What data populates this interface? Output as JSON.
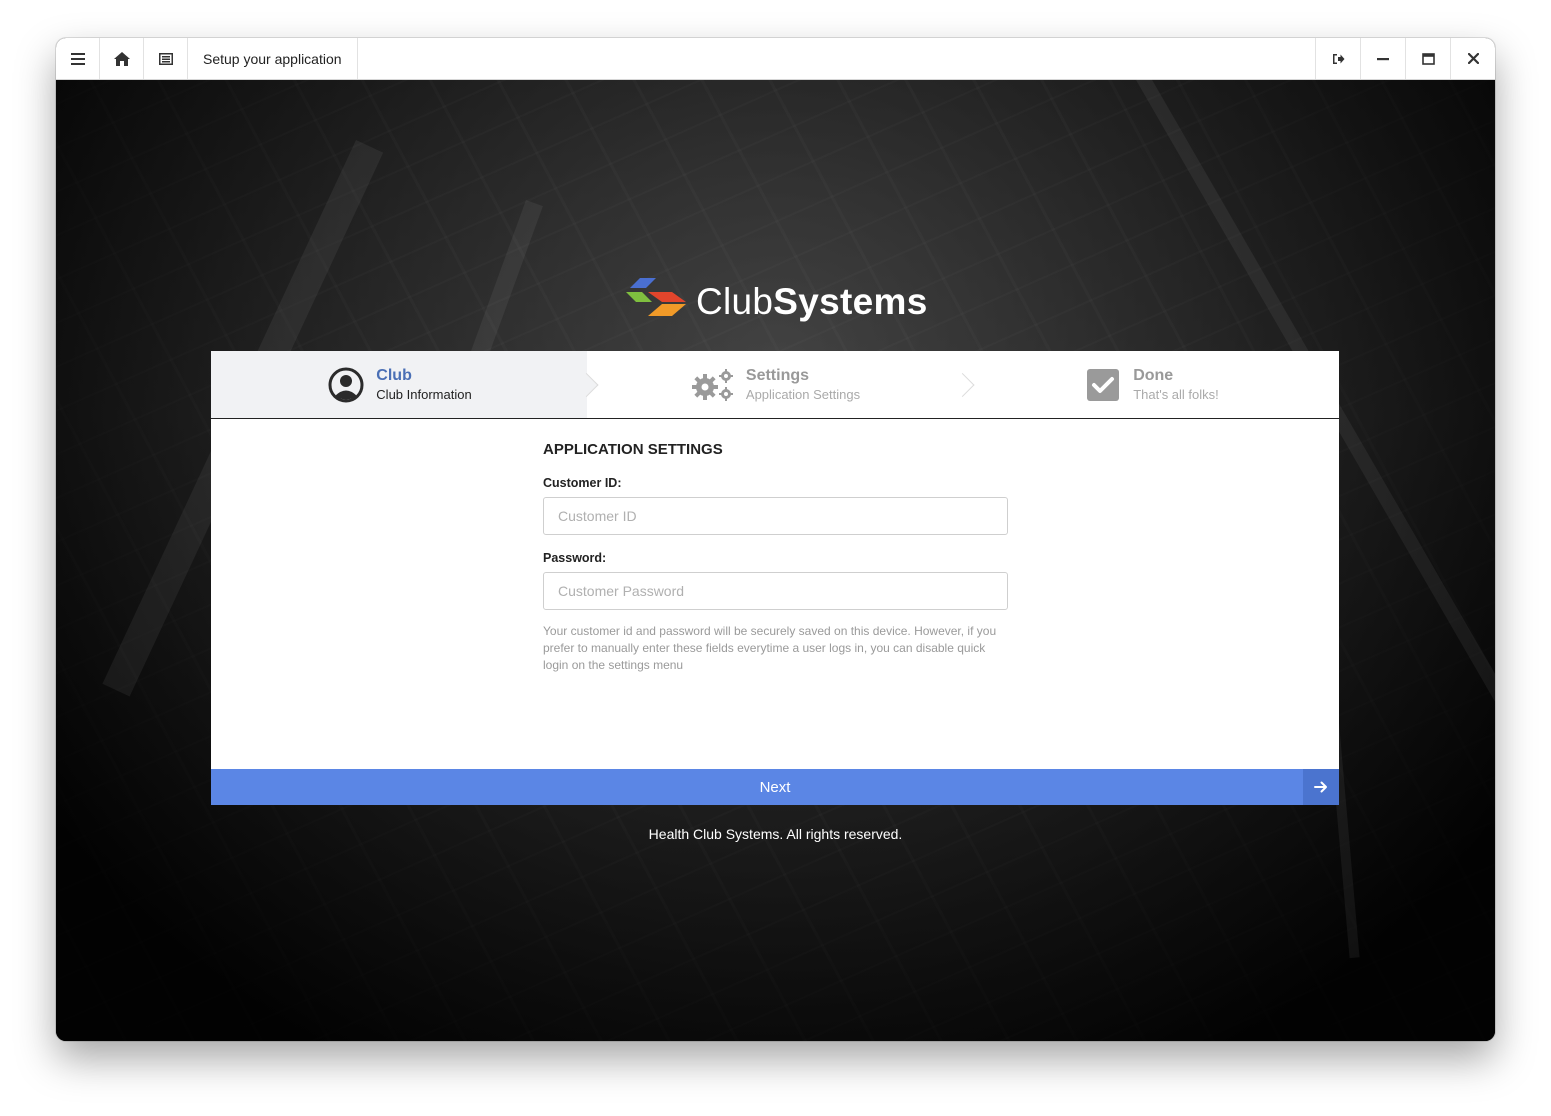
{
  "window": {
    "title": "Setup your application",
    "left_buttons": [
      {
        "icon": "hamburger-menu-icon"
      },
      {
        "icon": "home-icon"
      },
      {
        "icon": "list-icon"
      }
    ],
    "right_buttons": [
      {
        "icon": "logout-icon"
      },
      {
        "icon": "minimize-icon"
      },
      {
        "icon": "maximize-icon"
      },
      {
        "icon": "close-icon"
      }
    ]
  },
  "brand": {
    "name_regular": "Club",
    "name_bold": "Systems",
    "colors": [
      "#4a6fd1",
      "#7fbf3f",
      "#e2452c",
      "#f19a28"
    ]
  },
  "steps": [
    {
      "title": "Club",
      "subtitle": "Club Information",
      "icon": "user-circle-icon",
      "active": true
    },
    {
      "title": "Settings",
      "subtitle": "Application Settings",
      "icon": "gears-icon",
      "active": false
    },
    {
      "title": "Done",
      "subtitle": "That's all folks!",
      "icon": "checkbox-icon",
      "active": false
    }
  ],
  "form": {
    "section_title": "APPLICATION SETTINGS",
    "customer_id": {
      "label": "Customer ID:",
      "placeholder": "Customer ID",
      "value": ""
    },
    "password": {
      "label": "Password:",
      "placeholder": "Customer Password",
      "value": ""
    },
    "help_text": "Your customer id and password will be securely saved on this device. However, if you prefer to manually enter these fields everytime a user logs in, you can disable quick login on the settings menu"
  },
  "next_button": {
    "label": "Next",
    "icon": "arrow-right-icon",
    "color": "#5b86e5"
  },
  "footer": {
    "text": "Health Club Systems. All rights reserved."
  }
}
